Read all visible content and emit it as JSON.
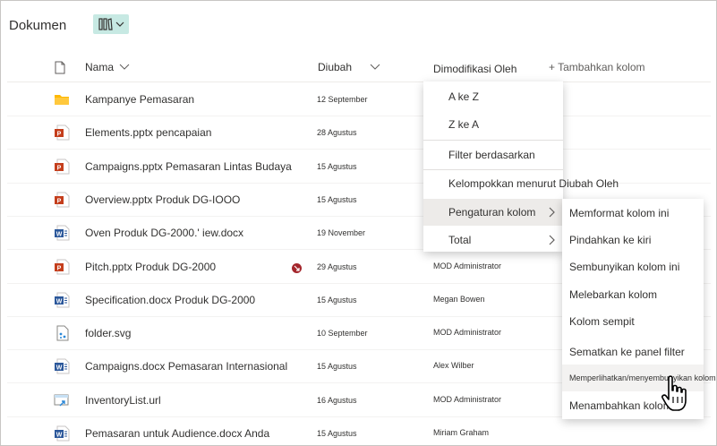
{
  "header": {
    "title": "Dokumen",
    "view_icon": "library-view-icon"
  },
  "columns": {
    "name": "Nama",
    "changed": "Diubah",
    "modified_by": "Dimodifikasi Oleh",
    "add_column": "+ Tambahkan kolom"
  },
  "rows": [
    {
      "type": "folder",
      "name": "Kampanye Pemasaran",
      "date": "12 September",
      "by": ""
    },
    {
      "type": "pptx",
      "name": "Elements.pptx pencapaian",
      "date": "28 Agustus",
      "by": ""
    },
    {
      "type": "pptx",
      "name": "Campaigns.pptx Pemasaran Lintas Budaya",
      "date": "15 Agustus",
      "by": ""
    },
    {
      "type": "pptx",
      "name": "Overview.pptx Produk DG-IOOO",
      "date": "15 Agustus",
      "by": ""
    },
    {
      "type": "docx",
      "name": "Oven Produk DG-2000.' iew.docx",
      "date": "19 November",
      "by": ""
    },
    {
      "type": "pptx",
      "name": "Pitch.pptx Produk DG-2000",
      "date": "29 Agustus",
      "by": "MOD Administrator"
    },
    {
      "type": "docx",
      "name": "Specification.docx Produk DG-2000",
      "date": "15 Agustus",
      "by": "Megan Bowen"
    },
    {
      "type": "svg",
      "name": "folder.svg",
      "date": "10 September",
      "by": "MOD Administrator"
    },
    {
      "type": "docx",
      "name": "Campaigns.docx Pemasaran Internasional",
      "date": "15 Agustus",
      "by": "Alex Wilber"
    },
    {
      "type": "url",
      "name": "InventoryList.url",
      "date": "16 Agustus",
      "by": "MOD Administrator"
    },
    {
      "type": "docx",
      "name": "Pemasaran untuk Audience.docx Anda",
      "date": "15 Agustus",
      "by": "Miriam Graham"
    }
  ],
  "column_menu": {
    "items": [
      "A ke Z",
      "Z ke A",
      "Filter berdasarkan",
      "Kelompokkan menurut Diubah Oleh",
      "Pengaturan kolom",
      "Total"
    ]
  },
  "submenu": {
    "items": [
      "Memformat kolom ini",
      "Pindahkan ke kiri",
      "Sembunyikan kolom ini",
      "Melebarkan kolom",
      "Kolom sempit",
      "Sematkan ke panel filter",
      "Memperlihatkan/menyembunyikan kolom",
      "Menambahkan kolom"
    ]
  },
  "colors": {
    "word": "#2b579a",
    "powerpoint": "#c43e1c",
    "folder": "#ffb900",
    "view_button": "#c7e9e3",
    "alert": "#a4262c"
  }
}
